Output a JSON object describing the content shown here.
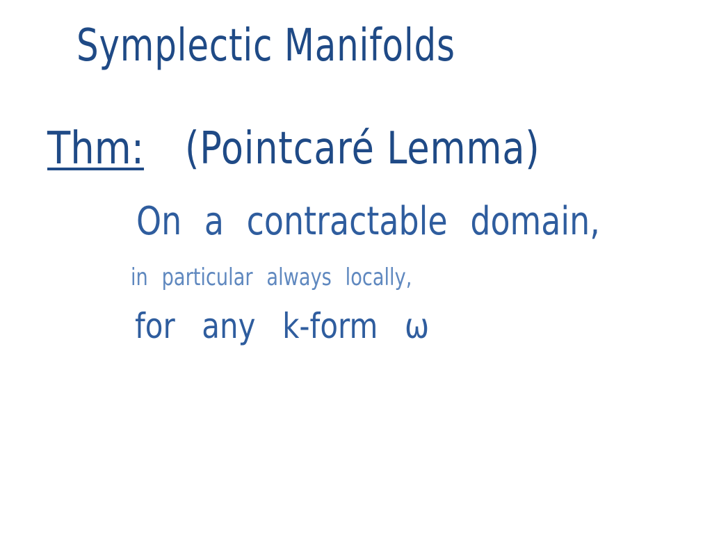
{
  "note": {
    "title": "Symplectic Manifolds",
    "theorem_label": "Thm:",
    "theorem_name": "(Pointcaré Lemma)",
    "lines": [
      "On a contractable domain,",
      "in particular always locally,",
      "for any k-form ω"
    ]
  },
  "colors": {
    "background": "#ffffff",
    "heading_ink": "#1f4a86",
    "body_ink": "#2f5d9e",
    "aside_ink": "#5f88bf"
  }
}
